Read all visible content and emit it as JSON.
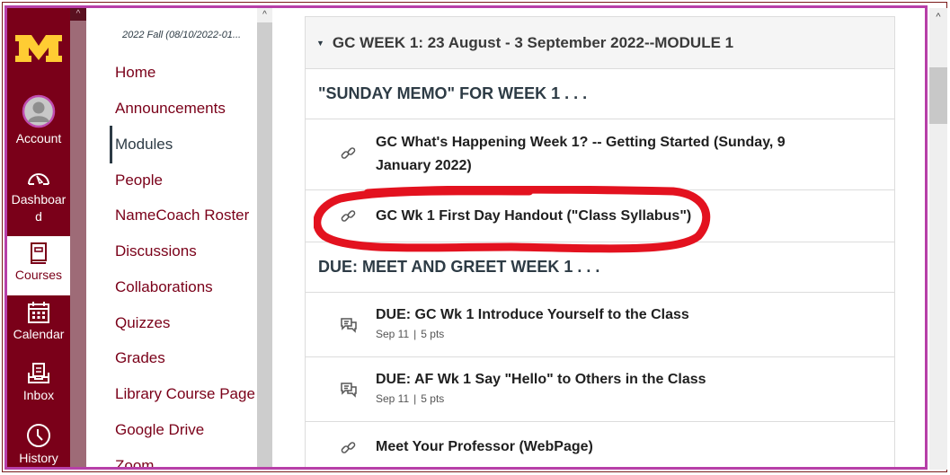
{
  "global_nav": {
    "logo": "university-m-logo",
    "items": [
      {
        "label": "Account",
        "icon": "avatar-icon"
      },
      {
        "label": "Dashboar d",
        "icon": "dashboard-gauge-icon"
      },
      {
        "label": "Courses",
        "icon": "book-icon",
        "active": true
      },
      {
        "label": "Calendar",
        "icon": "calendar-icon"
      },
      {
        "label": "Inbox",
        "icon": "inbox-icon"
      },
      {
        "label": "History",
        "icon": "clock-icon"
      }
    ],
    "scroll_up": "^"
  },
  "course_nav": {
    "term": "2022 Fall (08/10/2022-01...",
    "items": [
      {
        "label": "Home"
      },
      {
        "label": "Announcements"
      },
      {
        "label": "Modules",
        "active": true
      },
      {
        "label": "People"
      },
      {
        "label": "NameCoach Roster"
      },
      {
        "label": "Discussions"
      },
      {
        "label": "Collaborations"
      },
      {
        "label": "Quizzes"
      },
      {
        "label": "Grades"
      },
      {
        "label": "Library Course Page"
      },
      {
        "label": "Google Drive"
      },
      {
        "label": "Zoom"
      }
    ],
    "scroll_up": "^"
  },
  "module": {
    "caret": "▼",
    "title": "GC WEEK 1: 23 August - 3 September 2022--MODULE 1",
    "rows": [
      {
        "kind": "subheader",
        "text": "\"SUNDAY MEMO\" FOR WEEK 1 . . ."
      },
      {
        "kind": "item",
        "icon": "link-icon",
        "title": "GC What's Happening Week 1? -- Getting Started (Sunday, 9 January 2022)"
      },
      {
        "kind": "item",
        "icon": "link-icon",
        "title": "GC Wk 1 First Day Handout (\"Class Syllabus\")",
        "annotated": true
      },
      {
        "kind": "subheader",
        "text": "DUE: MEET AND GREET WEEK 1 . . ."
      },
      {
        "kind": "item",
        "icon": "discussion-icon",
        "title": "DUE: GC Wk 1 Introduce Yourself to the Class",
        "date": "Sep 11",
        "separator": "|",
        "points": "5 pts"
      },
      {
        "kind": "item",
        "icon": "discussion-icon",
        "title": "DUE: AF Wk 1 Say \"Hello\" to Others in the Class",
        "date": "Sep 11",
        "separator": "|",
        "points": "5 pts"
      },
      {
        "kind": "item",
        "icon": "link-icon",
        "title": "Meet Your Professor (WebPage)"
      }
    ]
  },
  "scrollbar": {
    "up": "^"
  },
  "colors": {
    "brand_maroon": "#7a0019",
    "brand_gold": "#ffcc33",
    "annotation_red": "#e3121f",
    "screenshot_frame": "#b73fa8",
    "text_dark": "#2d3b45"
  }
}
